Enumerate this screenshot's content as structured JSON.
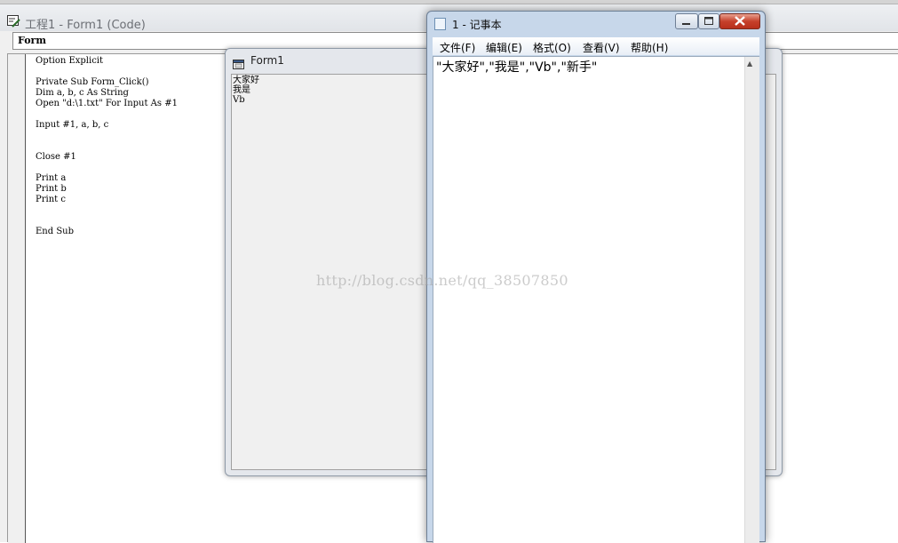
{
  "vb_ide": {
    "title": "工程1 - Form1 (Code)",
    "object_combo": "Form",
    "code_lines": [
      "Option Explicit",
      "",
      "Private Sub Form_Click()",
      "Dim a, b, c As String",
      "Open \"d:\\1.txt\" For Input As #1",
      "",
      "Input #1, a, b, c",
      "",
      "",
      "Close #1",
      "",
      "Print a",
      "Print b",
      "Print c",
      "",
      "",
      "End Sub"
    ]
  },
  "form1": {
    "title": "Form1",
    "output_lines": [
      "大家好",
      "我是",
      "Vb"
    ]
  },
  "notepad": {
    "title": "1 - 记事本",
    "menu": [
      "文件(F)",
      "编辑(E)",
      "格式(O)",
      "查看(V)",
      "帮助(H)"
    ],
    "content": "\"大家好\",\"我是\",\"Vb\",\"新手\""
  },
  "watermark": "http://blog.csdn.net/qq_38507850"
}
